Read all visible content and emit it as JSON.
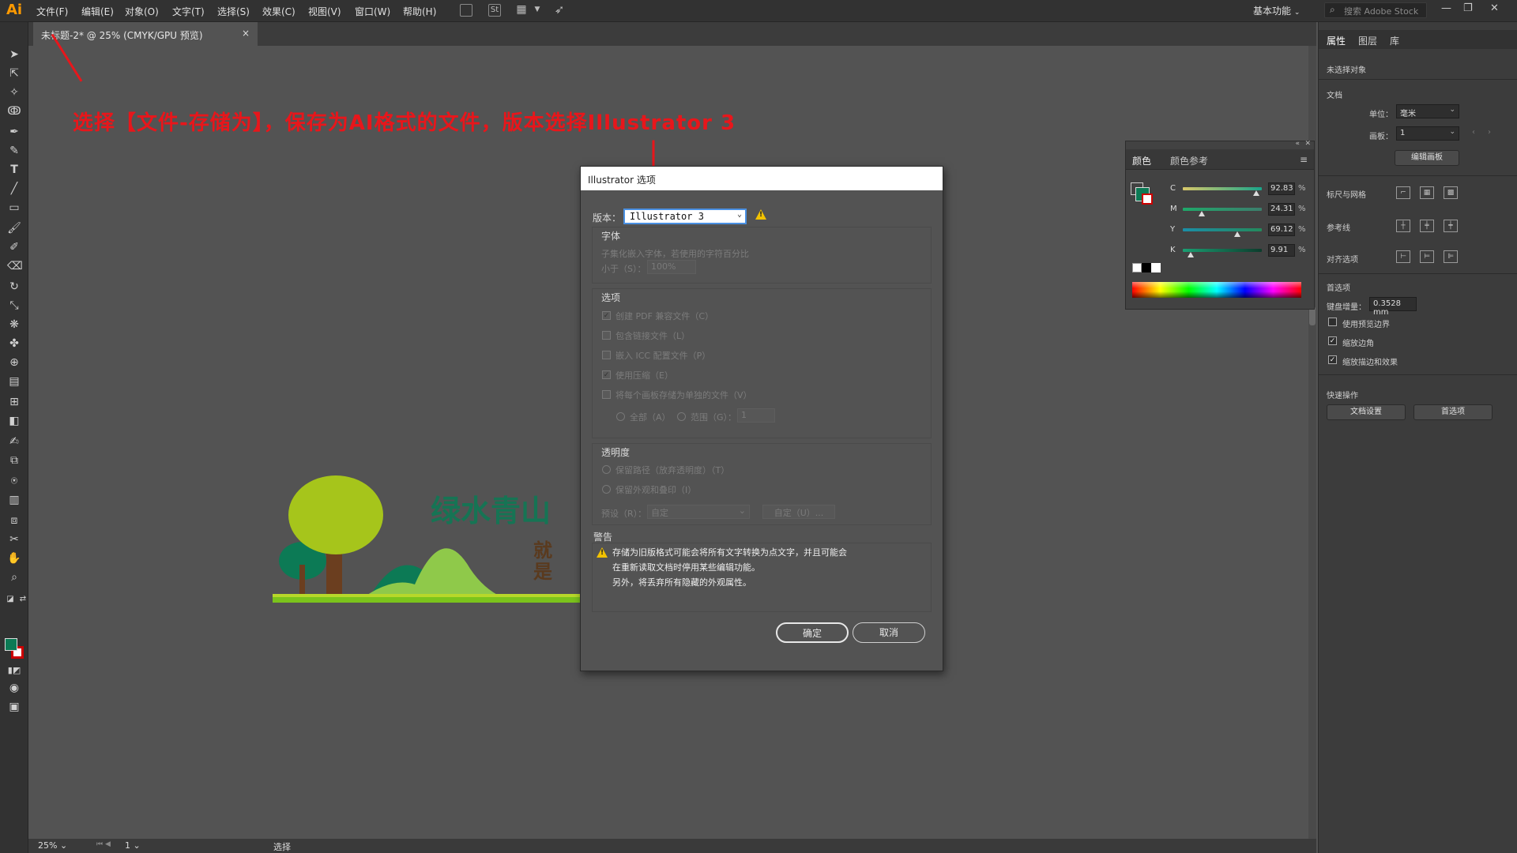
{
  "app": {
    "logo": "Ai",
    "workspace": "基本功能",
    "stock_search_placeholder": "搜索 Adobe Stock"
  },
  "menu": [
    "文件(F)",
    "编辑(E)",
    "对象(O)",
    "文字(T)",
    "选择(S)",
    "效果(C)",
    "视图(V)",
    "窗口(W)",
    "帮助(H)"
  ],
  "menu_icons": {
    "st_label": "St"
  },
  "document_tab": {
    "title": "未标题-2* @ 25% (CMYK/GPU 预览)",
    "close": "×"
  },
  "annotation": "选择【文件-存储为】，保存为AI格式的文件，版本选择Illustrator 3",
  "artwork": {
    "headline": "绿水青山",
    "sub_chars": [
      "就",
      "是"
    ]
  },
  "status": {
    "zoom": "25%",
    "page": "1",
    "text": "选择"
  },
  "color_panel": {
    "tabs": [
      "颜色",
      "颜色参考"
    ],
    "channels": [
      {
        "label": "C",
        "value": "92.83",
        "pct": "%",
        "level": 0.9283
      },
      {
        "label": "M",
        "value": "24.31",
        "pct": "%",
        "level": 0.2431
      },
      {
        "label": "Y",
        "value": "69.12",
        "pct": "%",
        "level": 0.6912
      },
      {
        "label": "K",
        "value": "9.91",
        "pct": "%",
        "level": 0.0991
      }
    ],
    "fill_color": "#0c7a55"
  },
  "properties": {
    "tabs": [
      "属性",
      "图层",
      "库"
    ],
    "no_selection": "未选择对象",
    "document_header": "文档",
    "units_label": "单位：",
    "units_value": "毫米",
    "artboard_label": "画板：",
    "artboard_value": "1",
    "edit_artboard_button": "编辑画板",
    "rulers_grid": "标尺与网格",
    "guides": "参考线",
    "align_options": "对齐选项",
    "preferences": "首选项",
    "keyboard_increment_label": "键盘增量：",
    "keyboard_increment_value": "0.3528 mm",
    "checkboxes": [
      {
        "label": "使用预览边界",
        "checked": false
      },
      {
        "label": "缩放边角",
        "checked": true
      },
      {
        "label": "缩放描边和效果",
        "checked": true
      }
    ],
    "quick_actions": "快速操作",
    "doc_setup_button": "文档设置",
    "prefs_button": "首选项"
  },
  "dialog": {
    "title": "Illustrator 选项",
    "version_label": "版本：",
    "version_value": "Illustrator 3",
    "fonts_header": "字体",
    "fonts_subset_text": "子集化嵌入字体，若使用的字符百分比",
    "fonts_less_than": "小于（S）：",
    "fonts_pct": "100%",
    "options_header": "选项",
    "options": [
      {
        "label": "创建 PDF 兼容文件（C）",
        "checked": true
      },
      {
        "label": "包含链接文件（L）",
        "checked": false
      },
      {
        "label": "嵌入 ICC 配置文件（P）",
        "checked": false
      },
      {
        "label": "使用压缩（E）",
        "checked": true
      },
      {
        "label": "将每个画板存储为单独的文件（V）",
        "checked": false
      }
    ],
    "radio_all": "全部（A）",
    "radio_range": "范围（G）：",
    "range_value": "1",
    "transparency_header": "透明度",
    "transparency_options": [
      "保留路径（放弃透明度）（T）",
      "保留外观和叠印（I）"
    ],
    "preset_label": "预设（R）：",
    "preset_value": "自定",
    "custom_button": "自定（U）...",
    "warning_header": "警告",
    "warning_lines": [
      "存储为旧版格式可能会将所有文字转换为点文字，并且可能会",
      "在重新读取文档时停用某些编辑功能。",
      "另外，将丢弃所有隐藏的外观属性。"
    ],
    "ok": "确定",
    "cancel": "取消"
  },
  "colors": {
    "annotation_red": "#e8161b",
    "green_dark": "#0c7a55",
    "green_light": "#a6c51b"
  }
}
